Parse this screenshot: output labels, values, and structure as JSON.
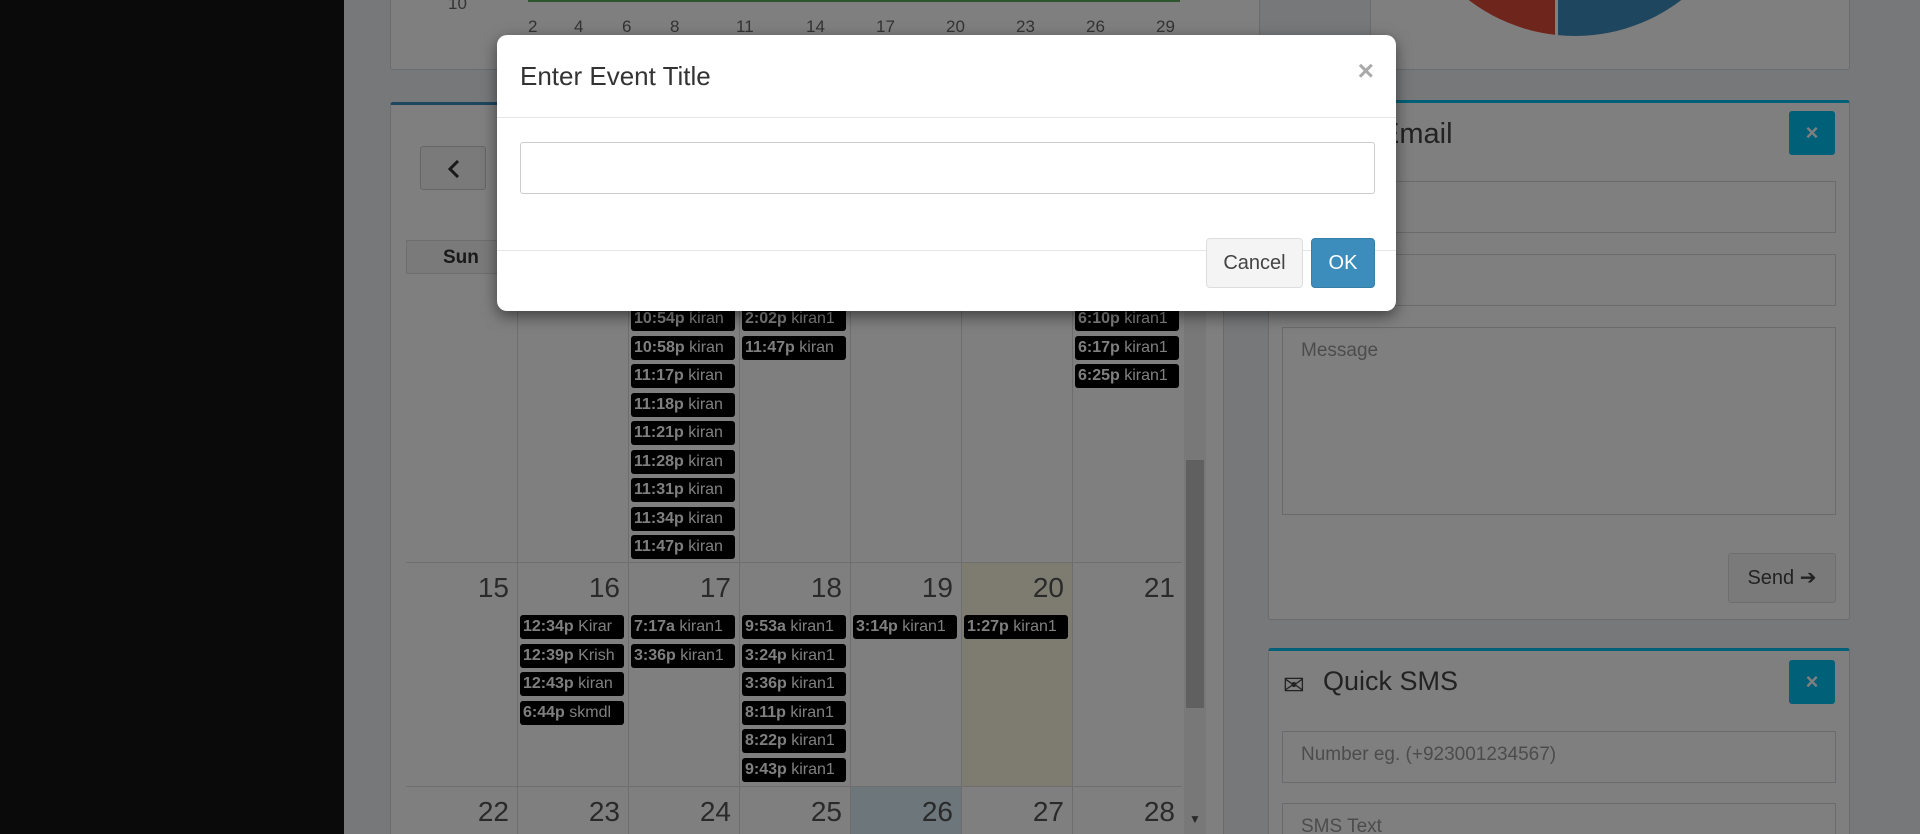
{
  "chart": {
    "y_tick": "10",
    "x_ticks": [
      "2",
      "4",
      "6",
      "8",
      "11",
      "14",
      "17",
      "20",
      "23",
      "26",
      "29"
    ]
  },
  "calendar": {
    "weekday_header": "Sun",
    "week_rows": [
      {
        "days": [
          "",
          "",
          "",
          "",
          "",
          "",
          ""
        ]
      },
      {
        "days": [
          "15",
          "16",
          "17",
          "18",
          "19",
          "20",
          "21"
        ]
      },
      {
        "days": [
          "22",
          "23",
          "24",
          "25",
          "26",
          "27",
          "28"
        ]
      }
    ],
    "events_row1": {
      "col2": [
        {
          "time": "10:54p",
          "title": "kiran"
        },
        {
          "time": "10:58p",
          "title": "kiran"
        },
        {
          "time": "11:17p",
          "title": "kiran"
        },
        {
          "time": "11:18p",
          "title": "kiran"
        },
        {
          "time": "11:21p",
          "title": "kiran"
        },
        {
          "time": "11:28p",
          "title": "kiran"
        },
        {
          "time": "11:31p",
          "title": "kiran"
        },
        {
          "time": "11:34p",
          "title": "kiran"
        },
        {
          "time": "11:47p",
          "title": "kiran"
        }
      ],
      "col3": [
        {
          "time": "2:02p",
          "title": "kiran1"
        },
        {
          "time": "11:47p",
          "title": "kiran"
        }
      ],
      "col6": [
        {
          "time": "6:10p",
          "title": "kiran1"
        },
        {
          "time": "6:17p",
          "title": "kiran1"
        },
        {
          "time": "6:25p",
          "title": "kiran1"
        }
      ]
    },
    "events_row2": {
      "col1": [
        {
          "time": "12:34p",
          "title": "Kirar"
        },
        {
          "time": "12:39p",
          "title": "Krish"
        },
        {
          "time": "12:43p",
          "title": "kiran"
        },
        {
          "time": "6:44p",
          "title": "skmdl"
        }
      ],
      "col2": [
        {
          "time": "7:17a",
          "title": "kiran1"
        },
        {
          "time": "3:36p",
          "title": "kiran1"
        }
      ],
      "col3": [
        {
          "time": "9:53a",
          "title": "kiran1"
        },
        {
          "time": "3:24p",
          "title": "kiran1"
        },
        {
          "time": "3:36p",
          "title": "kiran1"
        },
        {
          "time": "8:11p",
          "title": "kiran1"
        },
        {
          "time": "8:22p",
          "title": "kiran1"
        },
        {
          "time": "9:43p",
          "title": "kiran1"
        }
      ],
      "col4": [
        {
          "time": "3:14p",
          "title": "kiran1"
        }
      ],
      "col5": [
        {
          "time": "1:27p",
          "title": "kiran1"
        }
      ]
    }
  },
  "email_widget": {
    "title": "Email",
    "close": "×",
    "message_placeholder": "Message",
    "send_label": "Send"
  },
  "sms_widget": {
    "title": "Quick SMS",
    "close": "×",
    "number_placeholder": "Number eg. (+923001234567)",
    "text_placeholder": "SMS Text"
  },
  "modal": {
    "title": "Enter Event Title",
    "close": "×",
    "input_value": "",
    "cancel_label": "Cancel",
    "ok_label": "OK"
  }
}
